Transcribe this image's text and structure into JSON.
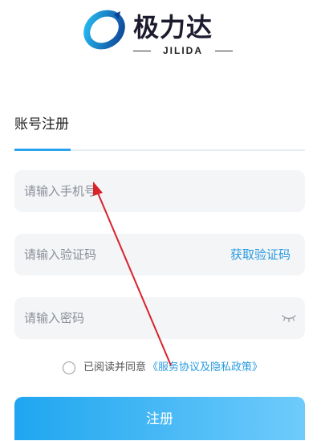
{
  "brand": {
    "name_cn": "极力达",
    "name_en": "JILIDA",
    "colors": {
      "mark_dark": "#0e3a8a",
      "mark_light": "#22b5f0"
    }
  },
  "tab": {
    "title": "账号注册"
  },
  "form": {
    "phone": {
      "placeholder": "请输入手机号"
    },
    "code": {
      "placeholder": "请输入验证码",
      "get_code": "获取验证码"
    },
    "password": {
      "placeholder": "请输入密码",
      "visibility_icon": "eye-closed-icon"
    }
  },
  "agreement": {
    "text": "已阅读并同意",
    "link": "《服务协议及隐私政策》"
  },
  "register": {
    "label": "注册"
  },
  "colors": {
    "accent": "#2aa3ee",
    "link": "#2a9be0",
    "field_bg": "#f4f5f7",
    "annotation": "#d8232a"
  }
}
